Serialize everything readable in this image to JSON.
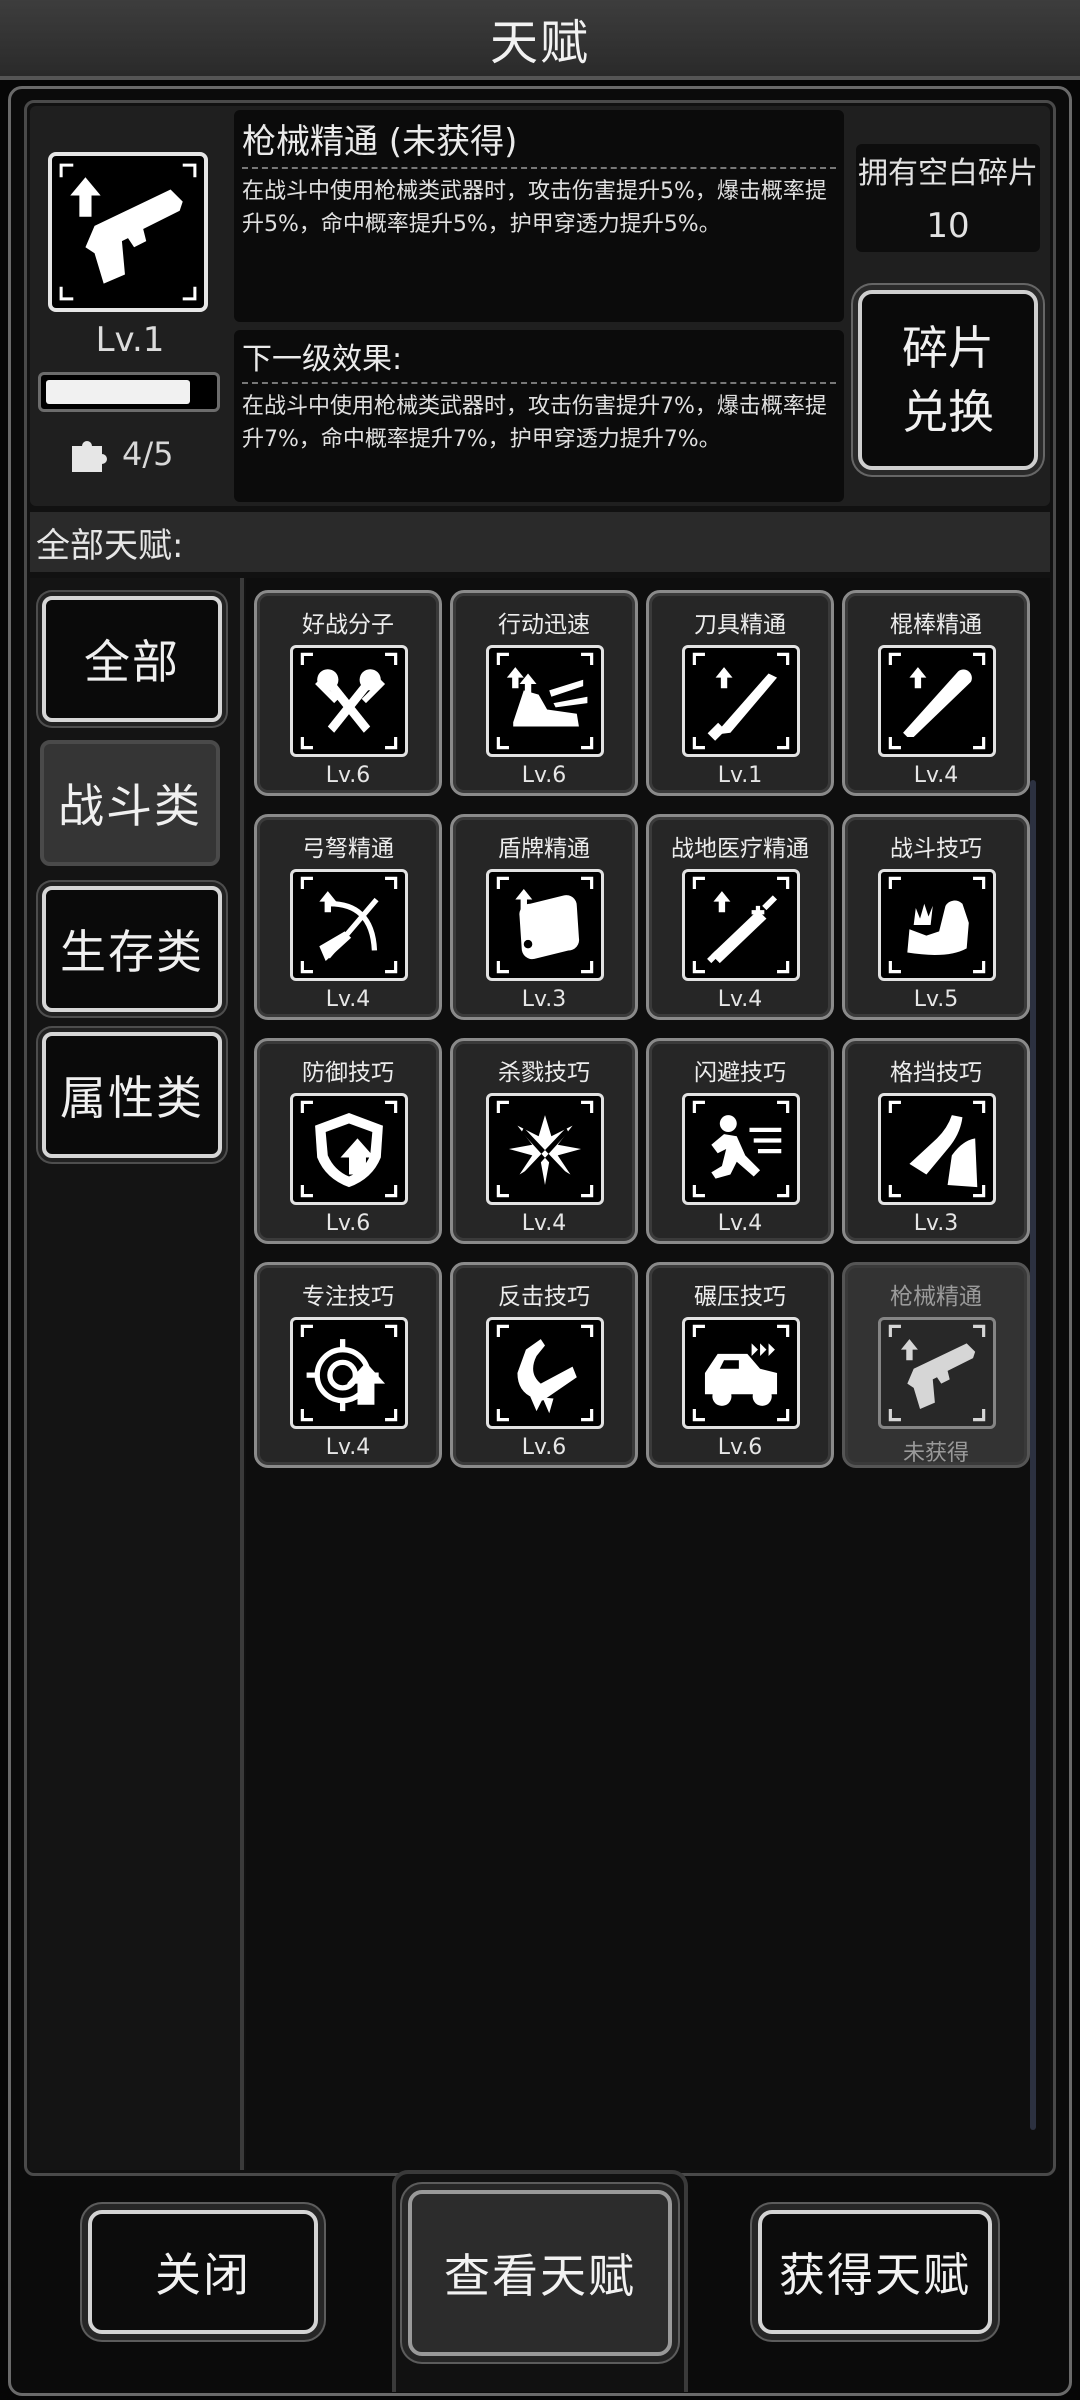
{
  "header": {
    "title": "天赋"
  },
  "selected_talent": {
    "name": "枪械精通 (未获得)",
    "description": "在战斗中使用枪械类武器时，攻击伤害提升5%，爆击概率提升5%，命中概率提升5%，护甲穿透力提升5%。",
    "next_heading": "下一级效果:",
    "next_description": "在战斗中使用枪械类武器时，攻击伤害提升7%，爆击概率提升7%，命中概率提升7%，护甲穿透力提升7%。",
    "level": "Lv.1",
    "progress": 0.87,
    "fragments": "4/5",
    "icon": "pistol-up-icon"
  },
  "blank_fragments": {
    "label": "拥有空白碎片",
    "value": "10"
  },
  "exchange_button": "碎片兑换",
  "all_talents_label": "全部天赋:",
  "categories": [
    {
      "label": "全部",
      "active": false
    },
    {
      "label": "战斗类",
      "active": true
    },
    {
      "label": "生存类",
      "active": false
    },
    {
      "label": "属性类",
      "active": false
    }
  ],
  "talents": [
    {
      "name": "好战分子",
      "level": "Lv.6",
      "icon": "crossed-axes-icon"
    },
    {
      "name": "行动迅速",
      "level": "Lv.6",
      "icon": "running-shoe-icon"
    },
    {
      "name": "刀具精通",
      "level": "Lv.1",
      "icon": "machete-icon"
    },
    {
      "name": "棍棒精通",
      "level": "Lv.4",
      "icon": "bat-icon"
    },
    {
      "name": "弓弩精通",
      "level": "Lv.4",
      "icon": "crossbow-icon"
    },
    {
      "name": "盾牌精通",
      "level": "Lv.3",
      "icon": "shield-icon"
    },
    {
      "name": "战地医疗精通",
      "level": "Lv.4",
      "icon": "syringe-icon"
    },
    {
      "name": "战斗技巧",
      "level": "Lv.5",
      "icon": "flexed-arm-icon"
    },
    {
      "name": "防御技巧",
      "level": "Lv.6",
      "icon": "defense-shield-icon"
    },
    {
      "name": "杀戮技巧",
      "level": "Lv.4",
      "icon": "slash-burst-icon"
    },
    {
      "name": "闪避技巧",
      "level": "Lv.4",
      "icon": "dodge-figure-icon"
    },
    {
      "name": "格挡技巧",
      "level": "Lv.3",
      "icon": "block-arm-icon"
    },
    {
      "name": "专注技巧",
      "level": "Lv.4",
      "icon": "crosshair-icon"
    },
    {
      "name": "反击技巧",
      "level": "Lv.6",
      "icon": "counter-arm-icon"
    },
    {
      "name": "碾压技巧",
      "level": "Lv.6",
      "icon": "car-crash-icon"
    },
    {
      "name": "枪械精通",
      "level": "未获得",
      "icon": "pistol-up-icon",
      "locked": true
    }
  ],
  "bottom_buttons": {
    "close": "关闭",
    "view": "查看天赋",
    "get": "获得天赋"
  }
}
